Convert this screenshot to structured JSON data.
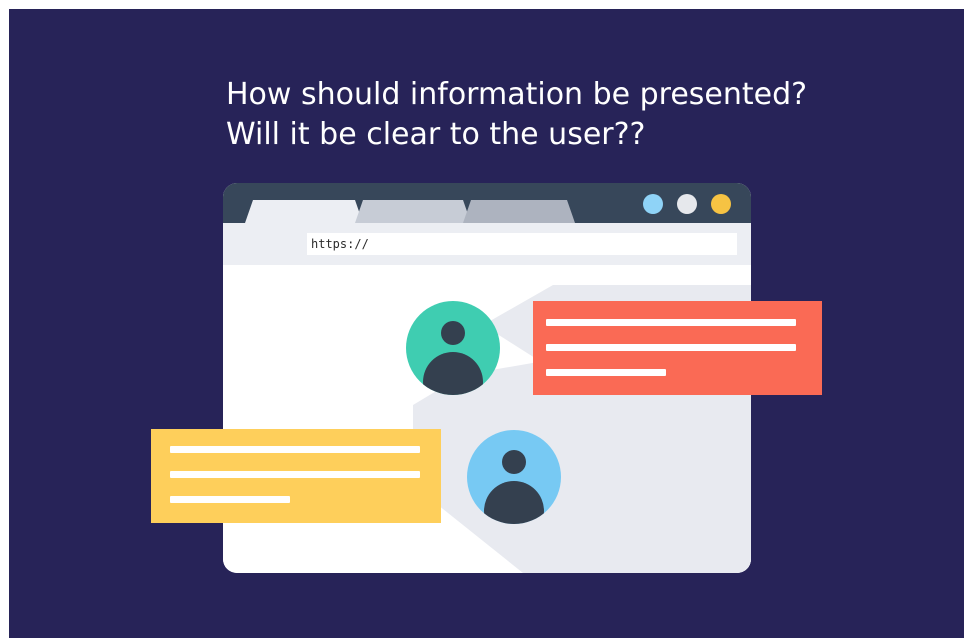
{
  "headline": {
    "line1": "How should information be presented?",
    "line2": "Will it be clear to the user??"
  },
  "browser": {
    "url": "https://"
  },
  "icons": {
    "window_dots": [
      "dot-blue-icon",
      "dot-gray-icon",
      "dot-yellow-icon"
    ],
    "avatars": [
      "user-avatar-icon",
      "user-avatar-icon"
    ]
  },
  "colors": {
    "background": "#272358",
    "titlebar": "#37475a",
    "card_red": "#fa6a55",
    "card_yellow": "#fecf5b",
    "avatar_green": "#3fcdb1",
    "avatar_blue": "#77c9f3",
    "dot_blue": "#8fd3f7",
    "dot_gray": "#e6e8ec",
    "dot_yellow": "#f6c343"
  }
}
